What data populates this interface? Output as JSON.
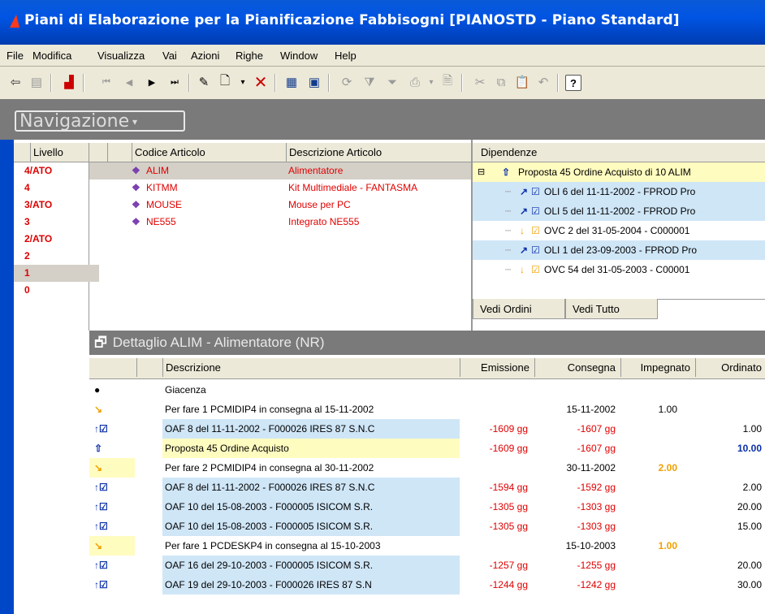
{
  "window": {
    "title": "Piani di Elaborazione per la Pianificazione Fabbisogni [PIANOSTD - Piano Standard]"
  },
  "menu": [
    {
      "label": "File",
      "u": "F",
      "rest": "ile"
    },
    {
      "label": "Modifica",
      "u": "",
      "rest": "Modifica"
    },
    {
      "label": "Visualizza",
      "u": "V",
      "rest": "isualizza"
    },
    {
      "label": "Vai",
      "u": "",
      "rest": "Vai"
    },
    {
      "label": "Azioni",
      "u": "A",
      "rest": "zioni"
    },
    {
      "label": "Righe",
      "u": "R",
      "rest": "ighe"
    },
    {
      "label": "Window",
      "u": "W",
      "rest": "indow"
    },
    {
      "label": "Help",
      "u": "H",
      "rest": "elp"
    }
  ],
  "toolbar": {
    "icons": [
      "exit-icon",
      "properties-icon",
      "signal-icon",
      "first-record-icon",
      "prev-record-icon",
      "next-record-icon",
      "last-record-icon",
      "edit-icon",
      "new-icon",
      "dropdown-arrow-icon",
      "delete-icon",
      "grid-view-icon",
      "form-view-icon",
      "refresh-icon",
      "filter-icon",
      "filter-funnel-icon",
      "print-icon",
      "print-dropdown-icon",
      "print-preview-icon",
      "cut-icon",
      "copy-icon",
      "paste-icon",
      "undo-icon",
      "help-icon"
    ]
  },
  "nav": {
    "label": "Navigazione"
  },
  "levels": {
    "header": "Livello",
    "items": [
      "4/ATO",
      "4",
      "3/ATO",
      "3",
      "2/ATO",
      "2",
      "1",
      "0"
    ],
    "selected_index": 6
  },
  "articles": {
    "headers": [
      "Codice Articolo",
      "Descrizione Articolo"
    ],
    "rows": [
      {
        "code": "ALIM",
        "desc": "Alimentatore"
      },
      {
        "code": "KITMM",
        "desc": "Kit Multimediale - FANTASMA"
      },
      {
        "code": "MOUSE",
        "desc": "Mouse per PC"
      },
      {
        "code": "NE555",
        "desc": "Integrato NE555"
      }
    ]
  },
  "dependencies": {
    "header": "Dipendenze",
    "root": "Proposta 45 Ordine Acquisto di 10 ALIM",
    "children": [
      {
        "text": "OLI 6 del 11-11-2002 - FPROD Pro",
        "type": "up"
      },
      {
        "text": "OLI 5 del 11-11-2002 - FPROD Pro",
        "type": "up"
      },
      {
        "text": "OVC 2 del 31-05-2004 - C000001",
        "type": "down"
      },
      {
        "text": "OLI 1 del 23-09-2003 - FPROD Pro",
        "type": "up"
      },
      {
        "text": "OVC 54 del 31-05-2003 - C00001",
        "type": "down"
      }
    ],
    "tabs": [
      "Vedi Ordini",
      "Vedi Tutto"
    ]
  },
  "detail": {
    "title": "Dettaglio ALIM - Alimentatore (NR)",
    "headers": [
      "Descrizione",
      "Emissione",
      "Consegna",
      "Impegnato",
      "Ordinato"
    ],
    "rows": [
      {
        "icon": "●",
        "desc": "Giacenza",
        "em": "",
        "co": "",
        "imp": "",
        "ord": "",
        "style": "plain"
      },
      {
        "icon": "↘",
        "desc": "Per fare 1 PCMIDIP4 in consegna al 15-11-2002",
        "em": "",
        "co": "15-11-2002",
        "imp": "1.00",
        "ord": "",
        "style": "plain"
      },
      {
        "icon": "↑☑",
        "desc": "OAF 8 del 11-11-2002 - F000026 IRES 87 S.N.C",
        "em": "-1609 gg",
        "co": "-1607 gg",
        "imp": "",
        "ord": "1.00",
        "style": "blue"
      },
      {
        "icon": "⇧",
        "desc": "Proposta 45 Ordine Acquisto",
        "em": "-1609 gg",
        "co": "-1607 gg",
        "imp": "",
        "ord": "10.00",
        "style": "yellow"
      },
      {
        "icon": "↘",
        "desc": "Per fare 2 PCMIDIP4 in consegna al 30-11-2002",
        "em": "",
        "co": "30-11-2002",
        "imp": "2.00",
        "ord": "",
        "style": "plain"
      },
      {
        "icon": "↑☑",
        "desc": "OAF 8 del 11-11-2002 - F000026 IRES 87 S.N.C",
        "em": "-1594 gg",
        "co": "-1592 gg",
        "imp": "",
        "ord": "2.00",
        "style": "blue"
      },
      {
        "icon": "↑☑",
        "desc": "OAF 10 del 15-08-2003 - F000005 ISICOM S.R.",
        "em": "-1305 gg",
        "co": "-1303 gg",
        "imp": "",
        "ord": "20.00",
        "style": "blue"
      },
      {
        "icon": "↑☑",
        "desc": "OAF 10 del 15-08-2003 - F000005 ISICOM S.R.",
        "em": "-1305 gg",
        "co": "-1303 gg",
        "imp": "",
        "ord": "15.00",
        "style": "blue"
      },
      {
        "icon": "↘",
        "desc": "Per fare 1 PCDESKP4 in consegna al 15-10-2003",
        "em": "",
        "co": "15-10-2003",
        "imp": "1.00",
        "ord": "",
        "style": "plain"
      },
      {
        "icon": "↑☑",
        "desc": "OAF 16 del 29-10-2003 - F000005 ISICOM S.R.",
        "em": "-1257 gg",
        "co": "-1255 gg",
        "imp": "",
        "ord": "20.00",
        "style": "blue"
      },
      {
        "icon": "↑☑",
        "desc": "OAF 19 del 29-10-2003 - F000026 IRES 87 S.N",
        "em": "-1244 gg",
        "co": "-1242 gg",
        "imp": "",
        "ord": "30.00",
        "style": "blue"
      }
    ]
  },
  "colors": {
    "accent_blue": "#0054e3",
    "row_blue": "#cfe6f7",
    "row_yellow": "#fffcc0",
    "red": "#e00000",
    "orange": "#f0a000"
  }
}
